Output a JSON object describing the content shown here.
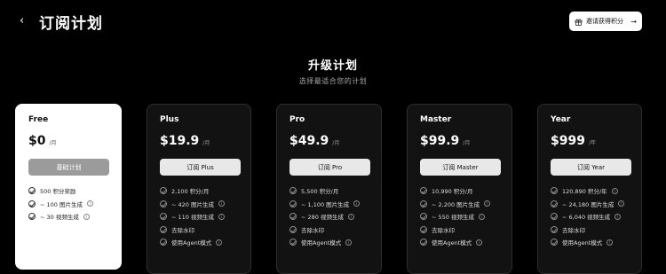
{
  "header": {
    "back_icon": "chevron-left-icon",
    "title": "订阅计划"
  },
  "invite": {
    "icon": "gift-icon",
    "label": "邀请获得积分",
    "arrow": "→"
  },
  "hero": {
    "title": "升级计划",
    "subtitle": "选择最适合您的计划"
  },
  "plans": [
    {
      "name": "Free",
      "price": "$0",
      "period": "/月",
      "button": "基础计划",
      "features": [
        {
          "text": "500 积分奖励",
          "info": false
        },
        {
          "text": "~ 100 图片生成",
          "info": true
        },
        {
          "text": "~ 30 视频生成",
          "info": true
        }
      ]
    },
    {
      "name": "Plus",
      "price": "$19.9",
      "period": "/月",
      "button": "订阅 Plus",
      "features": [
        {
          "text": "2,100 积分/月",
          "info": false
        },
        {
          "text": "~ 420 图片生成",
          "info": true
        },
        {
          "text": "~ 110 视频生成",
          "info": true
        },
        {
          "text": "去除水印",
          "info": false
        },
        {
          "text": "使用Agent模式",
          "info": true
        }
      ]
    },
    {
      "name": "Pro",
      "price": "$49.9",
      "period": "/月",
      "button": "订阅 Pro",
      "features": [
        {
          "text": "5,500 积分/月",
          "info": false
        },
        {
          "text": "~ 1,100 图片生成",
          "info": true
        },
        {
          "text": "~ 280 视频生成",
          "info": true
        },
        {
          "text": "去除水印",
          "info": false
        },
        {
          "text": "使用Agent模式",
          "info": true
        }
      ]
    },
    {
      "name": "Master",
      "price": "$99.9",
      "period": "/月",
      "button": "订阅 Master",
      "features": [
        {
          "text": "10,990 积分/月",
          "info": false
        },
        {
          "text": "~ 2,200 图片生成",
          "info": true
        },
        {
          "text": "~ 550 视频生成",
          "info": true
        },
        {
          "text": "去除水印",
          "info": false
        },
        {
          "text": "使用Agent模式",
          "info": true
        }
      ]
    },
    {
      "name": "Year",
      "price": "$999",
      "period": "/年",
      "button": "订阅 Year",
      "features": [
        {
          "text": "120,890 积分/年",
          "info": true
        },
        {
          "text": "~ 24,180 图片生成",
          "info": true
        },
        {
          "text": "~ 6,040 视频生成",
          "info": true
        },
        {
          "text": "去除水印",
          "info": false
        },
        {
          "text": "使用Agent模式",
          "info": true
        }
      ]
    }
  ],
  "colors": {
    "background": "#000000",
    "card_dark": "#121212",
    "card_light": "#ffffff",
    "button_light": "#e8e8e8",
    "button_disabled": "#9b9b9b"
  }
}
